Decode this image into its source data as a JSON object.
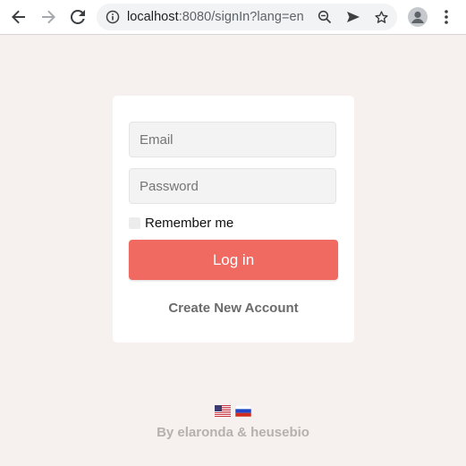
{
  "browser": {
    "url_host": "localhost",
    "url_rest": ":8080/signIn?lang=en",
    "icons": [
      "back-arrow-icon",
      "forward-arrow-icon",
      "reload-icon",
      "info-icon",
      "zoom-icon",
      "send-icon",
      "star-icon",
      "profile-icon",
      "kebab-menu-icon"
    ]
  },
  "login": {
    "email_placeholder": "Email",
    "password_placeholder": "Password",
    "remember_label": "Remember me",
    "login_button": "Log in",
    "create_account": "Create New Account"
  },
  "footer": {
    "languages": [
      "en",
      "ru"
    ],
    "credit": "By elaronda & heusebio"
  },
  "colors": {
    "page_bg": "#f6f1ee",
    "login_button": "#f06a62",
    "card_bg": "#ffffff"
  }
}
